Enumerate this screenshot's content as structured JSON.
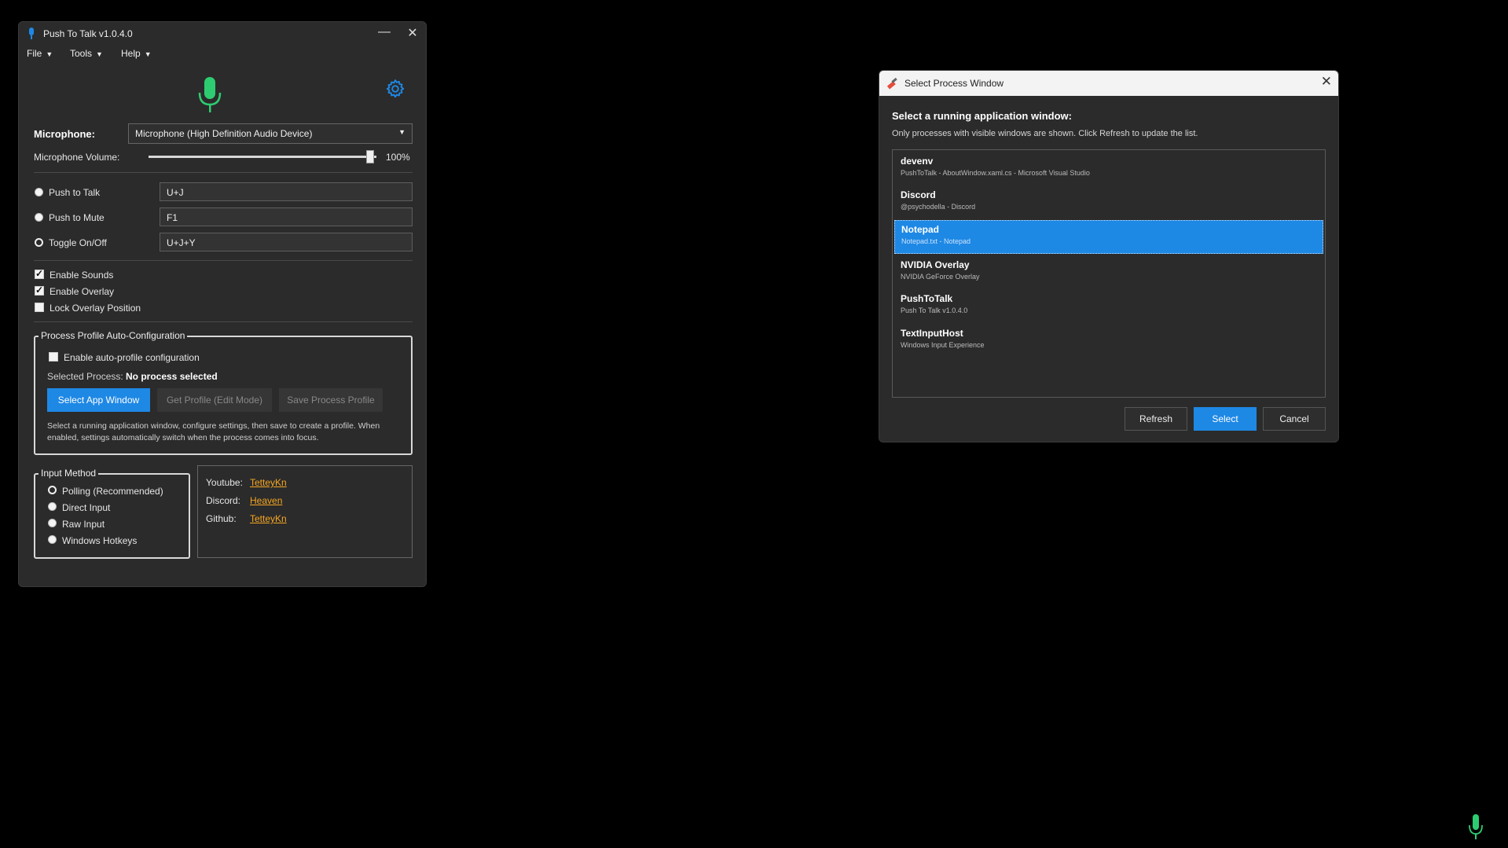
{
  "main_window": {
    "title": "Push To Talk v1.0.4.0",
    "menu": [
      "File",
      "Tools",
      "Help"
    ],
    "menu_caret": "▼",
    "microphone_label": "Microphone:",
    "microphone_value": "Microphone (High Definition Audio Device)",
    "volume_label": "Microphone Volume:",
    "volume_value": "100%",
    "volume_level": 1.0,
    "modes": [
      {
        "label": "Push to Talk",
        "hotkey": "U+J"
      },
      {
        "label": "Push to Mute",
        "hotkey": "F1"
      },
      {
        "label": "Toggle On/Off",
        "hotkey": "U+J+Y"
      }
    ],
    "options": [
      {
        "label": "Enable Sounds",
        "checked": true
      },
      {
        "label": "Enable Overlay",
        "checked": true
      },
      {
        "label": "Lock Overlay Position",
        "checked": false
      }
    ],
    "profile_group": {
      "legend": "Process Profile Auto-Configuration",
      "enable_label": "Enable auto-profile configuration",
      "selected_process_label": "Selected Process:",
      "selected_process_value": "No process selected",
      "select_button": "Select App Window",
      "get_profile_button": "Get Profile (Edit Mode)",
      "save_profile_button": "Save Process Profile",
      "help_line1": "Select a running application window, configure settings, then save to create a profile. When",
      "help_line2": "enabled, settings automatically switch when the process comes into focus."
    },
    "input_method": {
      "legend": "Input Method",
      "options": [
        "Polling (Recommended)",
        "Direct Input",
        "Raw Input",
        "Windows Hotkeys"
      ]
    },
    "links": [
      {
        "label": "Youtube:",
        "text": "TetteyKn"
      },
      {
        "label": "Discord:",
        "text": "Heaven"
      },
      {
        "label": "Github:",
        "text": "TetteyKn"
      }
    ]
  },
  "dialog": {
    "title": "Select Process Window",
    "heading": "Select a running application window:",
    "subtext": "Only processes with visible windows are shown. Click Refresh to update the list.",
    "processes": [
      {
        "name": "devenv",
        "desc": "PushToTalk - AboutWindow.xaml.cs - Microsoft Visual Studio"
      },
      {
        "name": "Discord",
        "desc": "@psychodella - Discord"
      },
      {
        "name": "Notepad",
        "desc": "Notepad.txt - Notepad"
      },
      {
        "name": "NVIDIA Overlay",
        "desc": "NVIDIA GeForce Overlay"
      },
      {
        "name": "PushToTalk",
        "desc": "Push To Talk v1.0.4.0"
      },
      {
        "name": "TextInputHost",
        "desc": "Windows Input Experience"
      }
    ],
    "refresh_button": "Refresh",
    "select_button": "Select",
    "cancel_button": "Cancel"
  },
  "colors": {
    "accent": "#1e88e5",
    "mic_green": "#2ecc71",
    "link": "#f5a623"
  }
}
